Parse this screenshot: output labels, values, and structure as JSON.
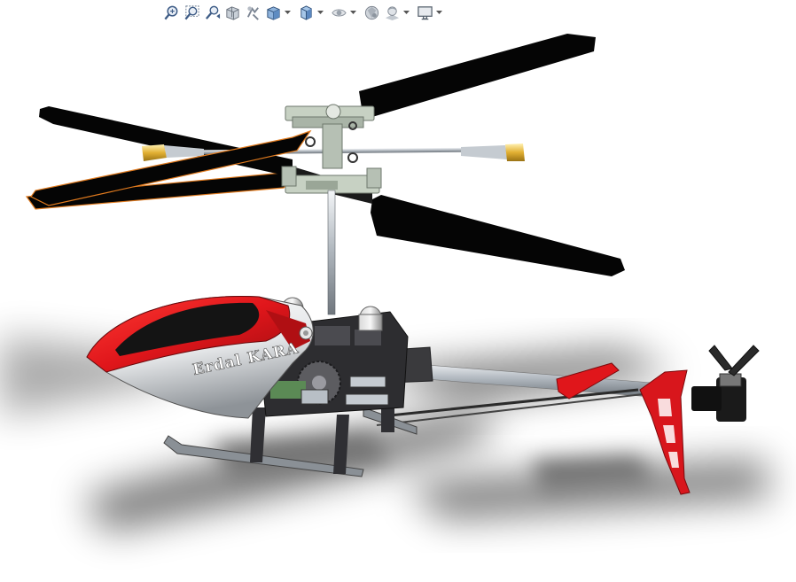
{
  "toolbar": {
    "items": [
      {
        "icon": "zoom-to-fit-icon",
        "dropdown": false
      },
      {
        "icon": "zoom-to-area-icon",
        "dropdown": false
      },
      {
        "icon": "previous-view-icon",
        "dropdown": false
      },
      {
        "icon": "section-view-icon",
        "dropdown": false
      },
      {
        "icon": "dynamic-annotation-views-icon",
        "dropdown": false
      },
      {
        "icon": "view-orientation-icon",
        "dropdown": true
      },
      {
        "icon": "display-style-icon",
        "dropdown": true
      },
      {
        "icon": "hide-show-items-icon",
        "dropdown": true
      },
      {
        "icon": "edit-appearance-icon",
        "dropdown": false
      },
      {
        "icon": "apply-scene-icon",
        "dropdown": true
      },
      {
        "icon": "view-settings-icon",
        "dropdown": true
      }
    ]
  },
  "model": {
    "signature": "Erdal KARA",
    "colors": {
      "rotor_blade": "#050505",
      "canopy_red": "#e3151a",
      "canopy_black": "#141414",
      "frame": "#2d2d30",
      "metal": "#b8bfc6",
      "tail_fin": "#d8161c",
      "blade_weight": "#e2b033"
    }
  }
}
